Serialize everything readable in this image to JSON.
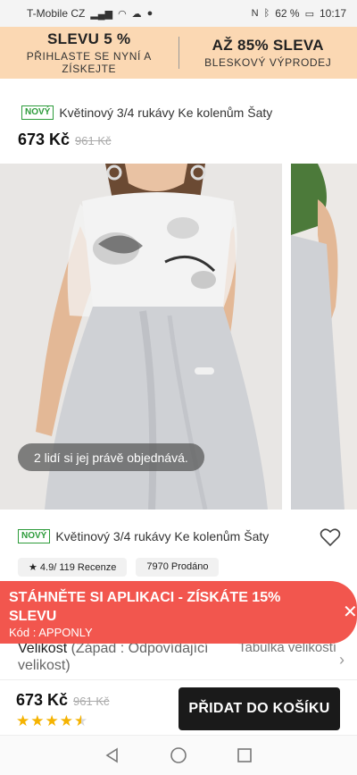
{
  "status_bar": {
    "carrier": "T-Mobile CZ",
    "battery": "62 %",
    "time": "10:17"
  },
  "promo": {
    "left_title": "SLEVU 5 %",
    "left_sub": "PŘIHLASTE SE NYNÍ A ZÍSKEJTE",
    "right_title": "AŽ 85% SLEVA",
    "right_sub": "BLESKOVÝ VÝPRODEJ"
  },
  "product": {
    "badge": "NOVÝ",
    "title": "Květinový 3/4 rukávy Ke kolenům Šaty",
    "price": "673 Kč",
    "old_price": "961 Kč"
  },
  "gallery": {
    "toast": "2 lidí si jej právě objednává."
  },
  "info": {
    "badge": "NOVÝ",
    "title": "Květinový 3/4 rukávy Ke kolenům Šaty",
    "rating_chip": "★ 4.9/ 119 Recenze",
    "sold_chip": "7970 Prodáno",
    "size_label": "Velikost",
    "size_note": "(Západ : Odpovídající velikost)",
    "size_table": "Tabulka velikostí"
  },
  "app_banner": {
    "title": "STÁHNĚTE SI APLIKACI - ZÍSKÁTE 15% SLEVU",
    "code": "Kód :  APPONLY"
  },
  "buy_bar": {
    "price": "673 Kč",
    "old_price": "961 Kč",
    "rating_stars": 4.5,
    "cart_label": "PŘIDAT DO KOŠÍKU"
  },
  "colors": {
    "promo_bg": "#fbd8b3",
    "badge_green": "#2c9b3a",
    "app_banner_red": "#f2564e",
    "star_yellow": "#f5b301",
    "cart_button": "#1a1a1a"
  }
}
